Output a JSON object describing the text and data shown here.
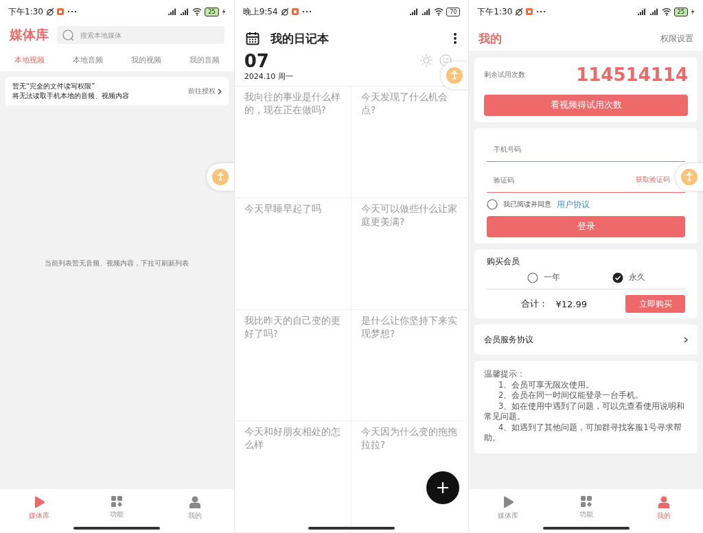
{
  "screens": [
    {
      "kind": "media",
      "status_bar": {
        "time": "下午1:30",
        "battery": "25",
        "charging": true
      },
      "title": "媒体库",
      "search": {
        "placeholder": "搜索本地媒体"
      },
      "tabs": [
        {
          "label": "本地视频",
          "selected": true
        },
        {
          "label": "本地音频",
          "selected": false
        },
        {
          "label": "我的视频",
          "selected": false
        },
        {
          "label": "我的音频",
          "selected": false
        }
      ],
      "notice": {
        "lines": [
          "暂无“完全的文件读写权限”",
          "将无法读取手机本地的音频、视频内容"
        ],
        "action": "前往授权"
      },
      "empty_text": "当前列表暂无音频、视频内容，下拉可刷新列表",
      "nav": [
        {
          "label": "媒体库",
          "selected": true
        },
        {
          "label": "功能",
          "selected": false
        },
        {
          "label": "我的",
          "selected": false
        }
      ]
    },
    {
      "kind": "diary",
      "status_bar": {
        "time": "晚上9:54",
        "battery": "70",
        "charging": false
      },
      "title": "我的日记本",
      "day": "07",
      "date": "2024.10 周一",
      "prompts": [
        "我向往的事业是什么样的，现在正在做吗?",
        "今天发现了什么机会点?",
        "今天早睡早起了吗",
        "今天可以做些什么让家庭更美满?",
        "我比昨天的自己变的更好了吗?",
        "是什么让你坚持下来实现梦想?",
        "今天和好朋友相处的怎么样",
        "今天因为什么变的拖拖拉拉?"
      ]
    },
    {
      "kind": "profile",
      "status_bar": {
        "time": "下午1:30",
        "battery": "25",
        "charging": true
      },
      "title": "我的",
      "action": "权限设置",
      "trial": {
        "label": "剩余试用次数",
        "count": "114514114",
        "button": "看视频得试用次数"
      },
      "login": {
        "phone_placeholder": "手机号码",
        "code_placeholder": "验证码",
        "get_code": "获取验证码",
        "agree_checked": false,
        "agree_text": "我已阅读并同意",
        "agreement_link": "用户协议",
        "button": "登录"
      },
      "purchase": {
        "title": "购买会员",
        "plans": [
          {
            "label": "一年",
            "selected": false
          },
          {
            "label": "永久",
            "selected": true
          }
        ],
        "total_label": "合计：",
        "price": "¥12.99",
        "button": "立即购买"
      },
      "service_agreement": "会员服务协议",
      "tips": {
        "title": "温馨提示：",
        "items": [
          "1、会员可享无限次使用。",
          "2、会员在同一时间仅能登录一台手机。",
          "3、如在使用中遇到了问题，可以先查看使用说明和常见问题。",
          "4、如遇到了其他问题，可加群寻找客服1号寻求帮助。"
        ]
      },
      "nav": [
        {
          "label": "媒体库",
          "selected": false
        },
        {
          "label": "功能",
          "selected": false
        },
        {
          "label": "我的",
          "selected": true
        }
      ]
    }
  ]
}
